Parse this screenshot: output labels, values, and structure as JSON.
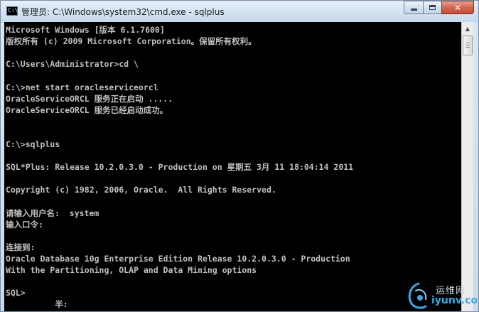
{
  "window": {
    "title": "管理员: C:\\Windows\\system32\\cmd.exe - sqlplus",
    "icon": "cmd-prompt-icon",
    "controls": {
      "minimize": "minimize-icon",
      "maximize": "maximize-icon",
      "close": "close-icon",
      "close_glyph": "✕"
    }
  },
  "console": {
    "lines": [
      "Microsoft Windows [版本 6.1.7600]",
      "版权所有 (c) 2009 Microsoft Corporation。保留所有权利。",
      "",
      "C:\\Users\\Administrator>cd \\",
      "",
      "C:\\>net start oracleserviceorcl",
      "OracleServiceORCL 服务正在启动 .....",
      "OracleServiceORCL 服务已经启动成功。",
      "",
      "",
      "C:\\>sqlplus",
      "",
      "SQL*Plus: Release 10.2.0.3.0 - Production on 星期五 3月 11 18:04:14 2011",
      "",
      "Copyright (c) 1982, 2006, Oracle.  All Rights Reserved.",
      "",
      "请输入用户名:  system",
      "输入口令:",
      "",
      "连接到:",
      "Oracle Database 10g Enterprise Edition Release 10.2.0.3.0 - Production",
      "With the Partitioning, OLAP and Data Mining options",
      "",
      "SQL>",
      "          半:"
    ],
    "colors": {
      "background": "#000000",
      "text": "#c0c0c0"
    }
  },
  "scrollbar": {
    "up_icon": "scroll-up-arrow-icon",
    "up_glyph": "▲",
    "thumb_position_fraction": 0.0
  },
  "watermark": {
    "text_cn": "运维网",
    "url": "iyunv.com",
    "accent_color": "#3aa6ea"
  }
}
